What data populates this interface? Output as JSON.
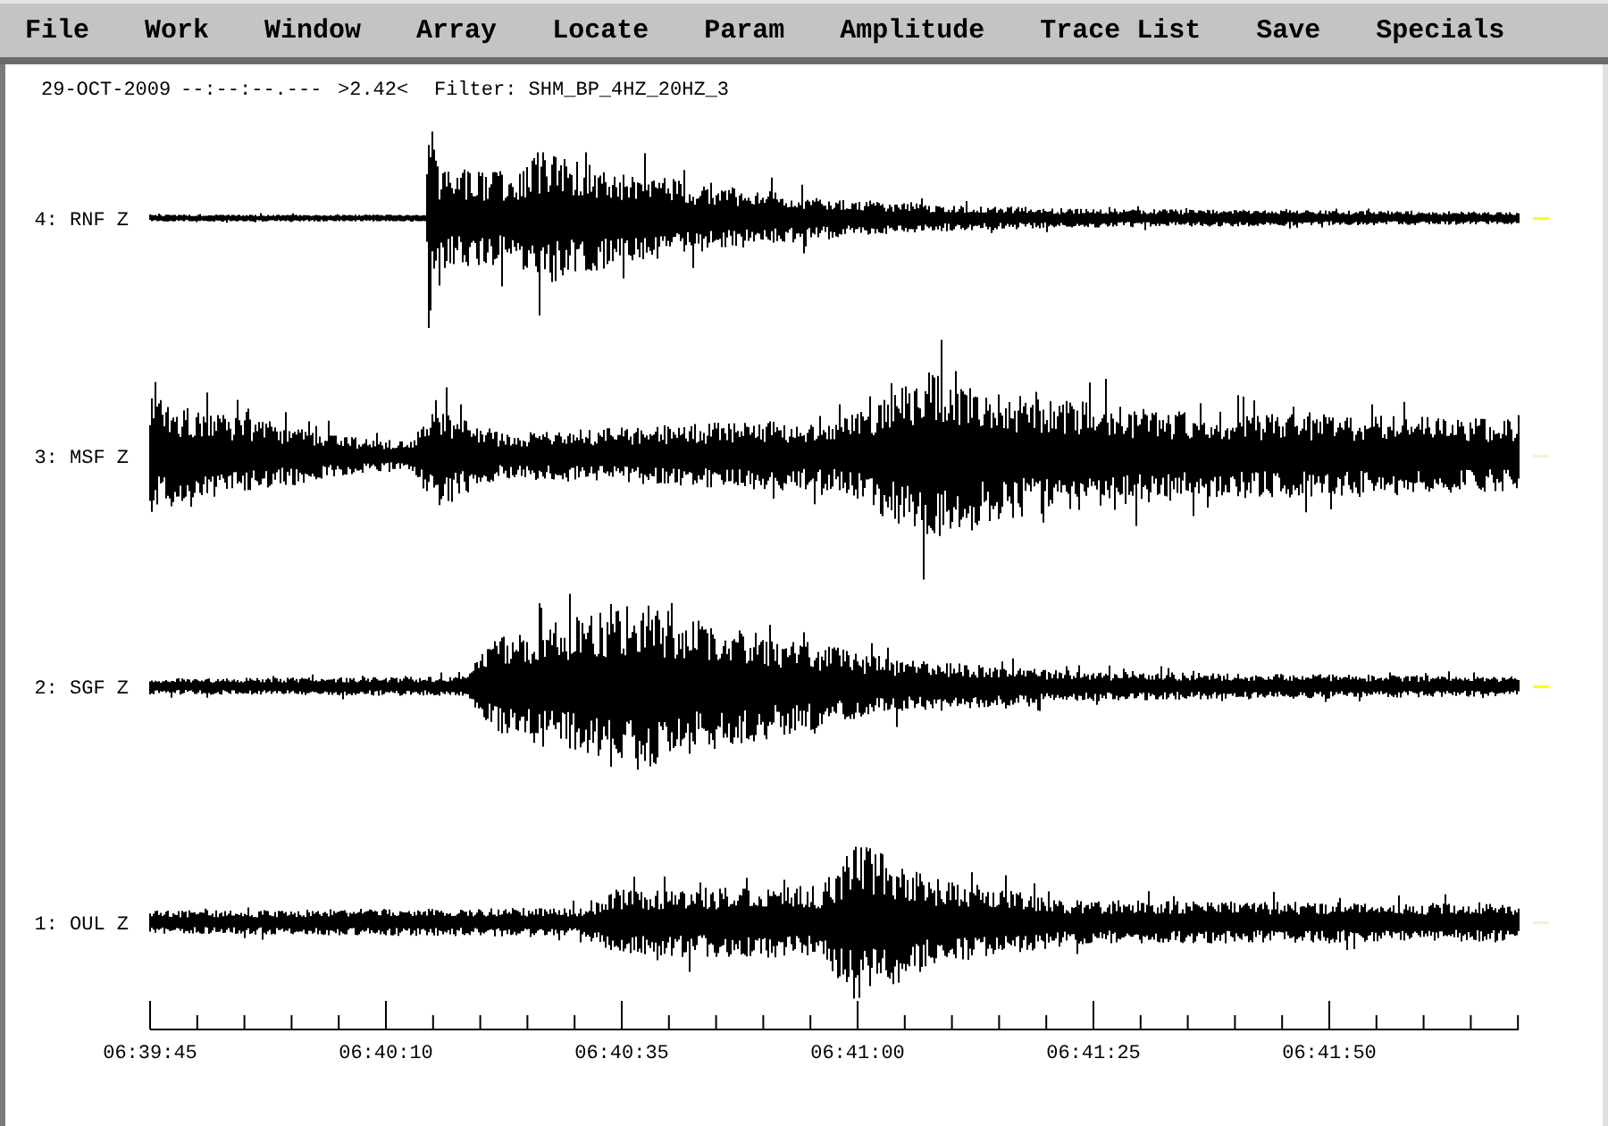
{
  "menu": [
    "File",
    "Work",
    "Window",
    "Array",
    "Locate",
    "Param",
    "Amplitude",
    "Trace List",
    "Save",
    "Specials"
  ],
  "header": {
    "date": "29-OCT-2009",
    "time": "--:--:--.---",
    "value": ">2.42<",
    "filter": "Filter: SHM_BP_4HZ_20HZ_3"
  },
  "traces": [
    {
      "label": "4: RNF Z",
      "selected": true
    },
    {
      "label": "3: MSF Z",
      "selected": false
    },
    {
      "label": "2: SGF Z",
      "selected": true
    },
    {
      "label": "1: OUL Z",
      "selected": false
    }
  ],
  "time_axis": {
    "labels": [
      "06:39:45",
      "06:40:10",
      "06:40:35",
      "06:41:00",
      "06:41:25",
      "06:41:50"
    ]
  }
}
